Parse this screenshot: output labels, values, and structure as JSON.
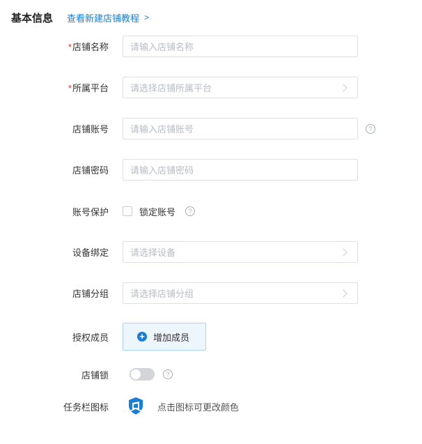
{
  "header": {
    "title": "基本信息",
    "tutorial_link": "查看新建店铺教程",
    "tutorial_chevron": ">"
  },
  "form": {
    "shop_name": {
      "required": "*",
      "label": "店铺名称",
      "placeholder": "请输入店铺名称"
    },
    "platform": {
      "required": "*",
      "label": "所属平台",
      "placeholder": "请选择店铺所属平台"
    },
    "account": {
      "label": "店铺账号",
      "placeholder": "请输入店铺账号",
      "help": "?"
    },
    "password": {
      "label": "店铺密码",
      "placeholder": "请输入店铺密码"
    },
    "account_protection": {
      "label": "账号保护",
      "checkbox_label": "锁定账号",
      "checked": false,
      "help": "?"
    },
    "device_binding": {
      "label": "设备绑定",
      "placeholder": "请选择设备"
    },
    "shop_group": {
      "label": "店铺分组",
      "placeholder": "请选择店铺分组"
    },
    "members": {
      "label": "授权成员",
      "button_label": "增加成员",
      "plus": "+"
    },
    "shop_lock": {
      "label": "店铺锁",
      "enabled": false,
      "help": "?"
    },
    "taskbar_icon": {
      "label": "任务栏图标",
      "hint": "点击图标可更改颜色",
      "icon_color": "#1a7dd7"
    }
  },
  "colors": {
    "accent": "#1a7dd7",
    "required": "#e0393e",
    "border": "#dcdfe6",
    "placeholder": "#b8bcc4"
  }
}
